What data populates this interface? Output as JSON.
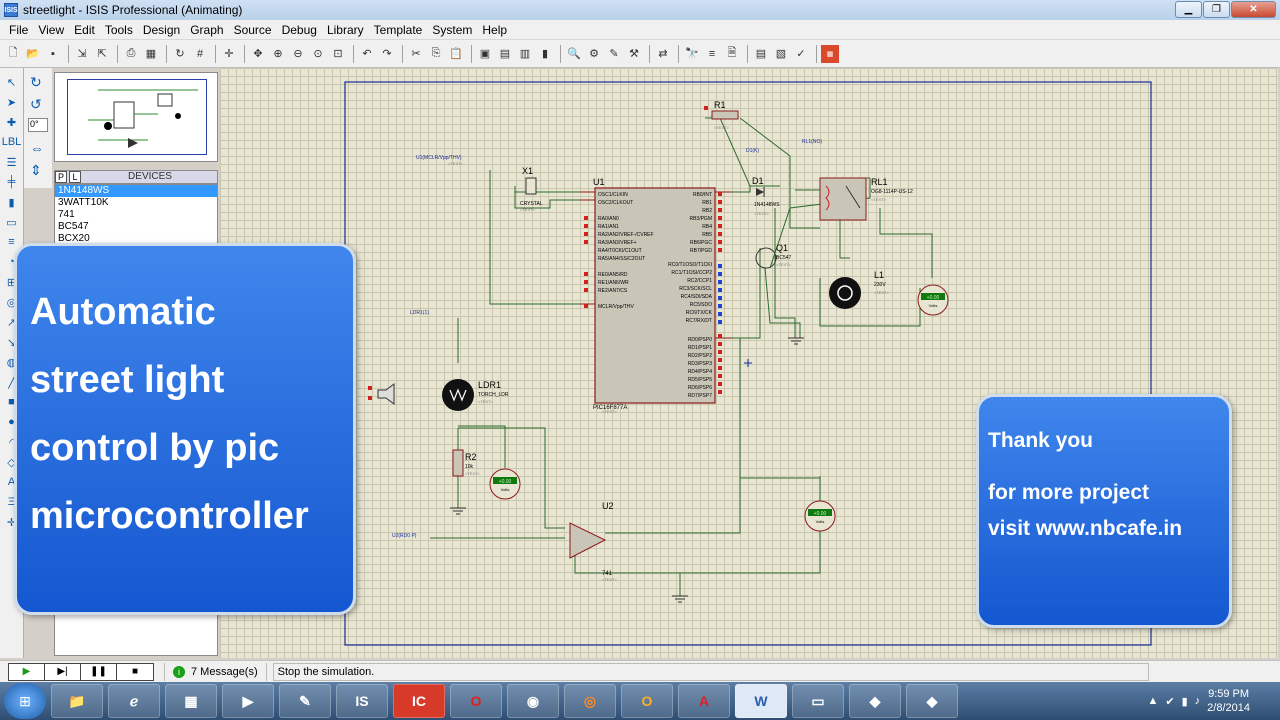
{
  "window": {
    "title": "streetlight - ISIS Professional (Animating)",
    "app_icon": "ISIS"
  },
  "menu": [
    "File",
    "View",
    "Edit",
    "Tools",
    "Design",
    "Graph",
    "Source",
    "Debug",
    "Library",
    "Template",
    "System",
    "Help"
  ],
  "rotation": {
    "angle": "0°"
  },
  "devices": {
    "tabs": [
      "P",
      "L"
    ],
    "title": "DEVICES",
    "items": [
      "1N4148WS",
      "3WATT10K",
      "741",
      "BC547",
      "BCX20"
    ],
    "selected": "1N4148WS"
  },
  "schematic": {
    "u1": {
      "ref": "U1",
      "part": "PIC16F877A",
      "left_pins": [
        "OSC1/CLKIN",
        "OSC2/CLKOUT",
        "RA0/AN0",
        "RA1/AN1",
        "RA2/AN2/VREF-/CVREF",
        "RA3/AN3/VREF+",
        "RA4/T0CKI/C1OUT",
        "RA5/AN4/SS/C2OUT",
        "RE0/AN5/RD",
        "RE1/AN6/WR",
        "RE2/AN7/CS",
        "MCLR/Vpp/THV"
      ],
      "right_pins": [
        "RB0/INT",
        "RB1",
        "RB2",
        "RB3/PGM",
        "RB4",
        "RB5",
        "RB6/PGC",
        "RB7/PGD",
        "RC0/T1OSO/T1CKI",
        "RC1/T1OSI/CCP2",
        "RC2/CCP1",
        "RC3/SCK/SCL",
        "RC4/SDI/SDA",
        "RC5/SDO",
        "RC6/TX/CK",
        "RC7/RX/DT",
        "RD0/PSP0",
        "RD1/PSP1",
        "RD2/PSP2",
        "RD3/PSP3",
        "RD4/PSP4",
        "RD5/PSP5",
        "RD6/PSP6",
        "RD7/PSP7"
      ]
    },
    "x1": {
      "ref": "X1",
      "part": "CRYSTAL"
    },
    "r1": {
      "ref": "R1"
    },
    "d1": {
      "ref": "D1",
      "part": "1N4148WS"
    },
    "q1": {
      "ref": "Q1",
      "part": "BC547"
    },
    "rl1": {
      "ref": "RL1",
      "part": "OG8-1114P-US-12"
    },
    "l1": {
      "ref": "L1",
      "part": "230V"
    },
    "ldr1": {
      "ref": "LDR1",
      "part": "TORCH_LDR"
    },
    "r2": {
      "ref": "R2",
      "part": "10k"
    },
    "u2": {
      "ref": "U2",
      "part": "741"
    },
    "terminals": [
      "U1(MCLR/Vpp/THV)",
      "D1(K)",
      "RL1(NO)",
      "LDR1(1)",
      "U2(RD0 P)"
    ],
    "text_placeholder": "<TEXT>",
    "voltmeter": {
      "value": "+0.00",
      "unit": "Volts"
    }
  },
  "overlay": {
    "left_lines": [
      "Automatic",
      "street light",
      "control by pic",
      "microcontroller"
    ],
    "right_line1": "Thank you",
    "right_line2": "for more project",
    "right_line3": "visit www.nbcafe.in"
  },
  "status": {
    "messages": "7 Message(s)",
    "text": "Stop the simulation."
  },
  "taskbar": {
    "apps": [
      "folder-icon",
      "ie-icon",
      "calculator-icon",
      "media-icon",
      "paint-icon",
      "isis-icon",
      "ic-icon",
      "opera-icon",
      "chrome-icon",
      "firefox-icon",
      "outlook-icon",
      "acrobat-icon",
      "word-icon",
      "screen-icon",
      "app1-icon",
      "app2-icon"
    ],
    "time": "9:59 PM",
    "date": "2/8/2014"
  }
}
